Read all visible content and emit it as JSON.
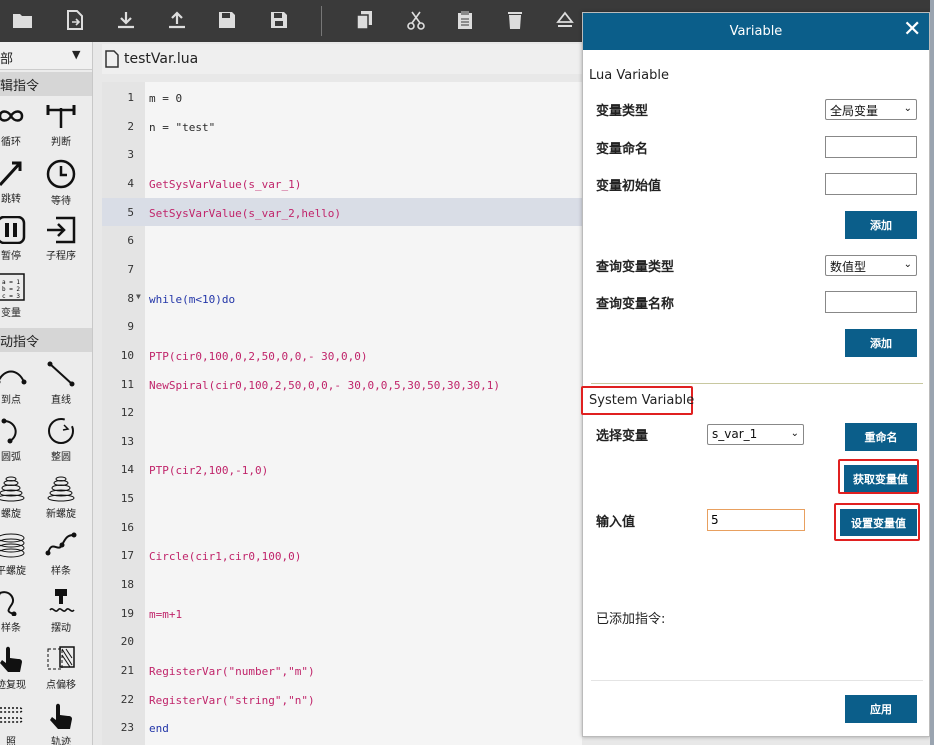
{
  "toolbar": {
    "icons": [
      "folder-open-icon",
      "file-export-icon",
      "download-icon",
      "upload-icon",
      "save-icon",
      "save-as-icon",
      "copy-icon",
      "cut-icon",
      "paste-icon",
      "delete-icon",
      "eject-icon"
    ]
  },
  "left_panel": {
    "dropdown_label": "部",
    "section_logic": "辑指令",
    "section_motion": "动指令",
    "commands": [
      {
        "label": "循环",
        "icon": "loop-icon"
      },
      {
        "label": "判断",
        "icon": "branch-icon"
      },
      {
        "label": "跳转",
        "icon": "jump-icon"
      },
      {
        "label": "等待",
        "icon": "clock-icon"
      },
      {
        "label": "暂停",
        "icon": "pause-icon"
      },
      {
        "label": "子程序",
        "icon": "subprogram-icon"
      },
      {
        "label": "变量",
        "icon": "variable-icon"
      },
      {
        "label": "到点",
        "icon": "point-icon"
      },
      {
        "label": "直线",
        "icon": "line-icon"
      },
      {
        "label": "圆弧",
        "icon": "arc-icon"
      },
      {
        "label": "整圆",
        "icon": "circle-icon"
      },
      {
        "label": "螺旋",
        "icon": "spiral-icon"
      },
      {
        "label": "新螺旋",
        "icon": "new-spiral-icon"
      },
      {
        "label": "平螺旋",
        "icon": "flat-spiral-icon"
      },
      {
        "label": "样条",
        "icon": "spline-icon"
      },
      {
        "label": "样条",
        "icon": "new-spline-icon"
      },
      {
        "label": "摆动",
        "icon": "weave-icon"
      },
      {
        "label": "迹复现",
        "icon": "trajectory-icon"
      },
      {
        "label": "点偏移",
        "icon": "offset-icon"
      },
      {
        "label": "照",
        "icon": "camera-icon"
      },
      {
        "label": "轨迹",
        "icon": "track-icon"
      }
    ]
  },
  "editor": {
    "filename": "testVar.lua",
    "active_line": 5,
    "lines": [
      {
        "n": "1",
        "text": "m = 0",
        "type": "plain"
      },
      {
        "n": "2",
        "text": "n = \"test\"",
        "type": "plain"
      },
      {
        "n": "3",
        "text": "",
        "type": "plain"
      },
      {
        "n": "4",
        "text": "GetSysVarValue(s_var_1)",
        "type": "fn"
      },
      {
        "n": "5",
        "text": "SetSysVarValue(s_var_2,hello)",
        "type": "fn"
      },
      {
        "n": "6",
        "text": "",
        "type": "plain"
      },
      {
        "n": "7",
        "text": "",
        "type": "plain"
      },
      {
        "n": "8",
        "text": "while(m<10)do",
        "type": "kw"
      },
      {
        "n": "9",
        "text": "",
        "type": "plain"
      },
      {
        "n": "10",
        "text": "PTP(cir0,100,0,2,50,0,0,- 30,0,0)",
        "type": "fn"
      },
      {
        "n": "11",
        "text": "NewSpiral(cir0,100,2,50,0,0,- 30,0,0,5,30,50,30,30,1)",
        "type": "fn"
      },
      {
        "n": "12",
        "text": "",
        "type": "plain"
      },
      {
        "n": "13",
        "text": "",
        "type": "plain"
      },
      {
        "n": "14",
        "text": "PTP(cir2,100,-1,0)",
        "type": "fn"
      },
      {
        "n": "15",
        "text": "",
        "type": "plain"
      },
      {
        "n": "16",
        "text": "",
        "type": "plain"
      },
      {
        "n": "17",
        "text": "Circle(cir1,cir0,100,0)",
        "type": "fn"
      },
      {
        "n": "18",
        "text": "",
        "type": "plain"
      },
      {
        "n": "19",
        "text": "m=m+1",
        "type": "fn"
      },
      {
        "n": "20",
        "text": "",
        "type": "plain"
      },
      {
        "n": "21",
        "text": "RegisterVar(\"number\",\"m\")",
        "type": "fn"
      },
      {
        "n": "22",
        "text": "RegisterVar(\"string\",\"n\")",
        "type": "fn"
      },
      {
        "n": "23",
        "text": "end",
        "type": "kw"
      }
    ]
  },
  "dialog": {
    "title": "Variable",
    "lua_section_title": "Lua Variable",
    "var_type_label": "变量类型",
    "var_type_value": "全局变量",
    "var_name_label": "变量命名",
    "var_name_value": "",
    "var_init_label": "变量初始值",
    "var_init_value": "",
    "add_label": "添加",
    "query_type_label": "查询变量类型",
    "query_type_value": "数值型",
    "query_name_label": "查询变量名称",
    "query_name_value": "",
    "add2_label": "添加",
    "system_section_title": "System Variable",
    "select_var_label": "选择变量",
    "select_var_value": "s_var_1",
    "rename_label": "重命名",
    "get_value_label": "获取变量值",
    "input_value_label": "输入值",
    "input_value": "5",
    "set_value_label": "设置变量值",
    "added_commands_label": "已添加指令:",
    "apply_label": "应用"
  }
}
